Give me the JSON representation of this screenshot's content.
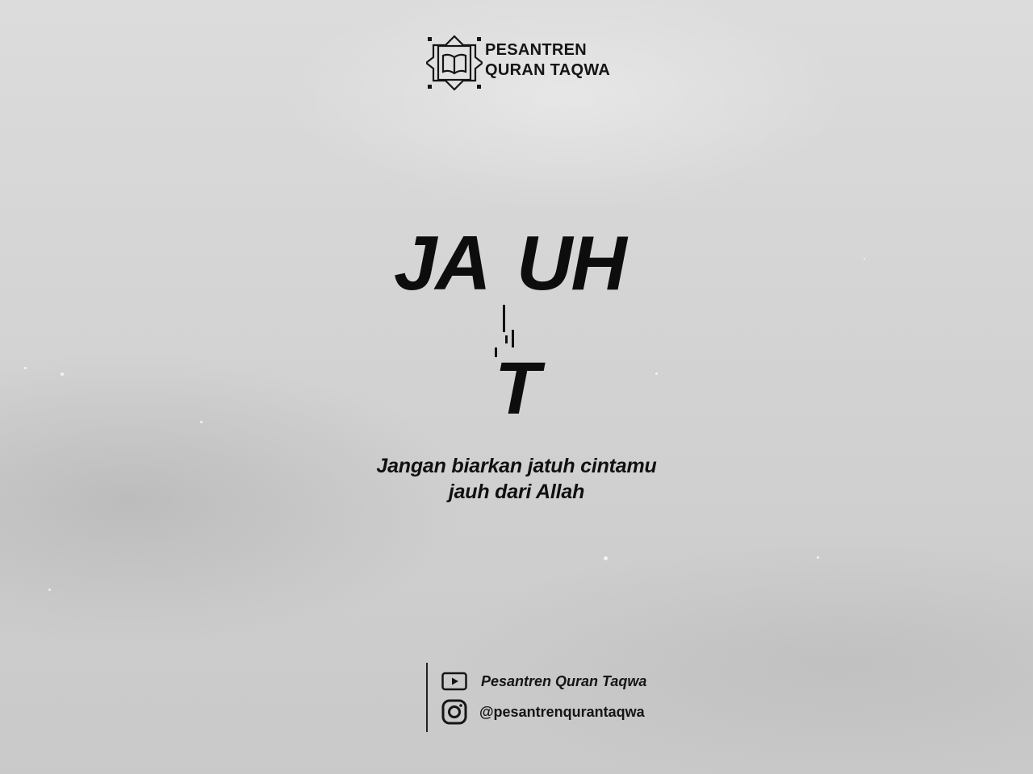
{
  "brand": {
    "line1": "PESANTREN",
    "line2": "QURAN TAQWA",
    "logo_icon": "open-quran-star-icon"
  },
  "headline": {
    "part1": "JA",
    "part2": "UH",
    "falling_letter": "T"
  },
  "tagline": {
    "line1": "Jangan biarkan jatuh cintamu",
    "line2": "jauh dari Allah"
  },
  "socials": {
    "youtube": {
      "icon": "youtube-icon",
      "label": "Pesantren Quran Taqwa"
    },
    "instagram": {
      "icon": "instagram-icon",
      "label": "@pesantrenqurantaqwa"
    }
  },
  "colors": {
    "background": "#d3d3d3",
    "text": "#111111"
  }
}
